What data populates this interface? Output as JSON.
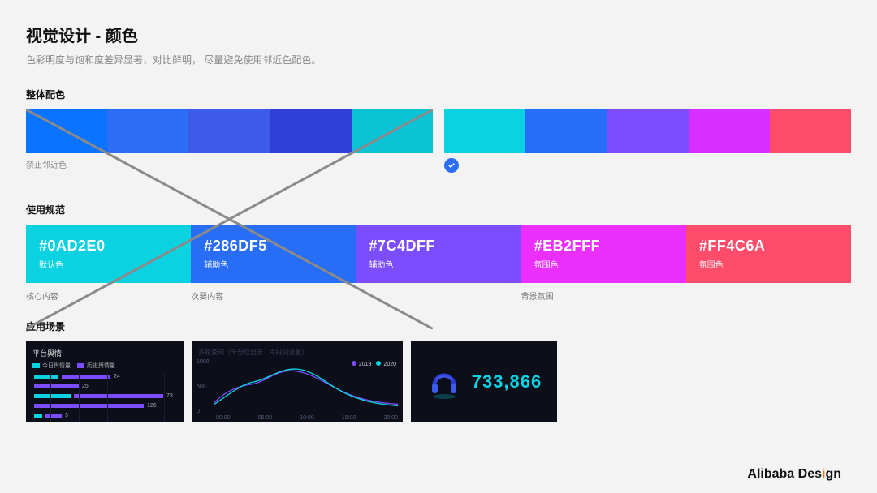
{
  "header": {
    "title": "视觉设计 - 颜色",
    "subtitle_before": "色彩明度与饱和度差异显著、对比鲜明，  尽量",
    "subtitle_underlined": "避免使用邻近色配色",
    "subtitle_after": "。"
  },
  "palettes": {
    "section_label": "整体配色",
    "left_label": "禁止邻近色",
    "left_colors": [
      "#0a73ff",
      "#2d6cf5",
      "#3b5be8",
      "#2f3fd6",
      "#0cc3d6"
    ],
    "right_colors": [
      "#0ad2e0",
      "#286df5",
      "#7c4dff",
      "#d62fff",
      "#ff4c6a"
    ]
  },
  "usage": {
    "section_label": "使用规范",
    "blocks": [
      {
        "hex": "#0AD2E0",
        "role": "默认色",
        "bg": "#0ad2e0"
      },
      {
        "hex": "#286DF5",
        "role": "辅助色",
        "bg": "#286df5"
      },
      {
        "hex": "#7C4DFF",
        "role": "辅助色",
        "bg": "#7c4dff"
      },
      {
        "hex": "#EB2FFF",
        "role": "氛围色",
        "bg": "#eb2fff"
      },
      {
        "hex": "#FF4C6A",
        "role": "氛围色",
        "bg": "#ff4c6a"
      }
    ],
    "captions": {
      "core": "核心内容",
      "secondary": "次要内容",
      "background": "背景氛围"
    }
  },
  "scenes": {
    "section_label": "应用场景",
    "scene1": {
      "title": "平台舆情",
      "legend": [
        {
          "label": "今日舆情量",
          "color": "#0ad2e0"
        },
        {
          "label": "历史舆情量",
          "color": "#7c4dff"
        }
      ],
      "bars": [
        {
          "value_label": "24",
          "cyan": 30,
          "purple": 60
        },
        {
          "value_label": "25",
          "cyan": 0,
          "purple": 55
        },
        {
          "value_label": "73",
          "cyan": 45,
          "purple": 110
        },
        {
          "value_label": "126",
          "cyan": 0,
          "purple": 135
        },
        {
          "value_label": "3",
          "cyan": 10,
          "purple": 20
        }
      ]
    },
    "scene2": {
      "faint_title": "多轮查询（千分位显示 · 片段闪流量）",
      "legend": [
        {
          "label": "2019",
          "color": "#7c4dff"
        },
        {
          "label": "2020",
          "color": "#0ad2e0"
        }
      ],
      "y_ticks": [
        "1000",
        "500",
        "0"
      ],
      "x_ticks": [
        "00:00",
        "05:00",
        "10:00",
        "15:00",
        "20:00"
      ]
    },
    "scene3": {
      "metric_value": "733,866"
    }
  },
  "chart_data": [
    {
      "type": "bar",
      "title": "平台舆情",
      "series": [
        {
          "name": "今日舆情量",
          "values": [
            30,
            0,
            45,
            0,
            10
          ]
        },
        {
          "name": "历史舆情量",
          "values": [
            60,
            55,
            110,
            135,
            20
          ]
        }
      ],
      "data_labels": [
        "24",
        "25",
        "73",
        "126",
        "3"
      ],
      "xlabel": "",
      "ylabel": ""
    },
    {
      "type": "line",
      "title": "多轮查询",
      "x": [
        "00:00",
        "05:00",
        "10:00",
        "15:00",
        "20:00"
      ],
      "series": [
        {
          "name": "2019",
          "values": [
            200,
            350,
            700,
            550,
            300
          ]
        },
        {
          "name": "2020",
          "values": [
            180,
            400,
            750,
            520,
            280
          ]
        }
      ],
      "ylim": [
        0,
        1000
      ],
      "xlabel": "",
      "ylabel": ""
    }
  ],
  "footer": {
    "brand_before": "Alibaba Des",
    "brand_i": "i",
    "brand_after": "gn"
  }
}
